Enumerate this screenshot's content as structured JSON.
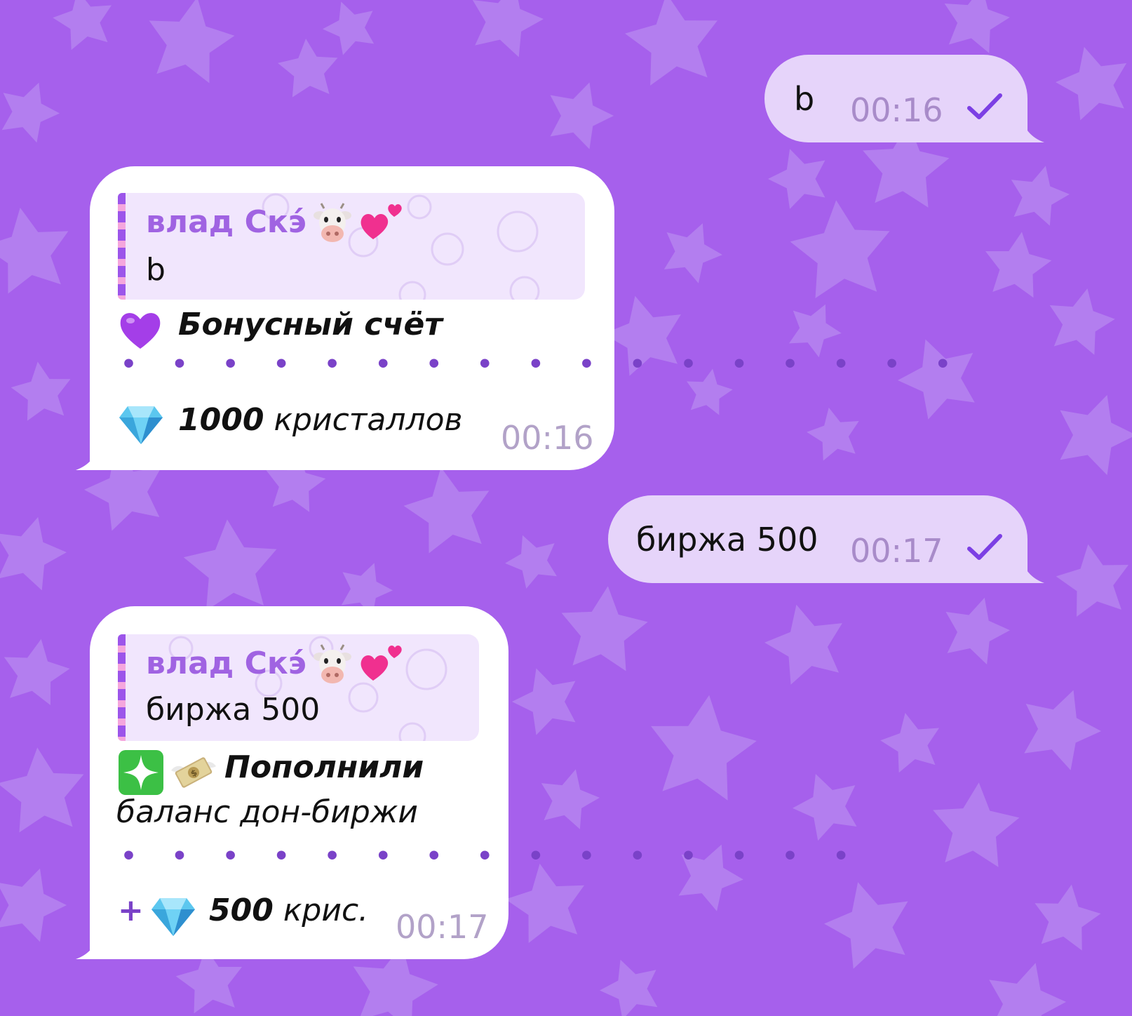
{
  "colors": {
    "background": "#a660ec",
    "star": "#b684f0",
    "outgoing_bubble": "#e6d4fa",
    "incoming_bubble": "#ffffff",
    "reply_background": "#f1e6fd",
    "sender_name": "#a063e2",
    "check": "#7c3fe4",
    "separator_dots": "#7a42c8",
    "time": "#a88bc9"
  },
  "messages": [
    {
      "direction": "outgoing",
      "text": "b",
      "time": "00:16",
      "status_icon": "check-icon"
    },
    {
      "direction": "incoming",
      "reply": {
        "sender": "влад Скэ́",
        "sender_emoji": [
          "cow-face-icon",
          "two-hearts-icon"
        ],
        "text": "b"
      },
      "title_icon": "purple-heart-icon",
      "title": "Бонусный счёт",
      "separator": "• • • • • • • • • • • • • • • • •",
      "amount_icon": "gem-icon",
      "amount_number": "1000",
      "amount_unit": "кристаллов",
      "time": "00:16"
    },
    {
      "direction": "outgoing",
      "text": "биржа 500",
      "time": "00:17",
      "status_icon": "check-icon"
    },
    {
      "direction": "incoming",
      "reply": {
        "sender": "влад Скэ́",
        "sender_emoji": [
          "cow-face-icon",
          "two-hearts-icon"
        ],
        "text": "биржа 500"
      },
      "title_icons": [
        "sparkle-icon",
        "money-with-wings-icon"
      ],
      "title": "Пополнили",
      "subtitle": "баланс дон-биржи",
      "separator": "• • • • • • • • • • • • • • •",
      "amount_prefix": "+",
      "amount_icon": "gem-icon",
      "amount_number": "500",
      "amount_unit": "крис.",
      "time": "00:17"
    }
  ]
}
